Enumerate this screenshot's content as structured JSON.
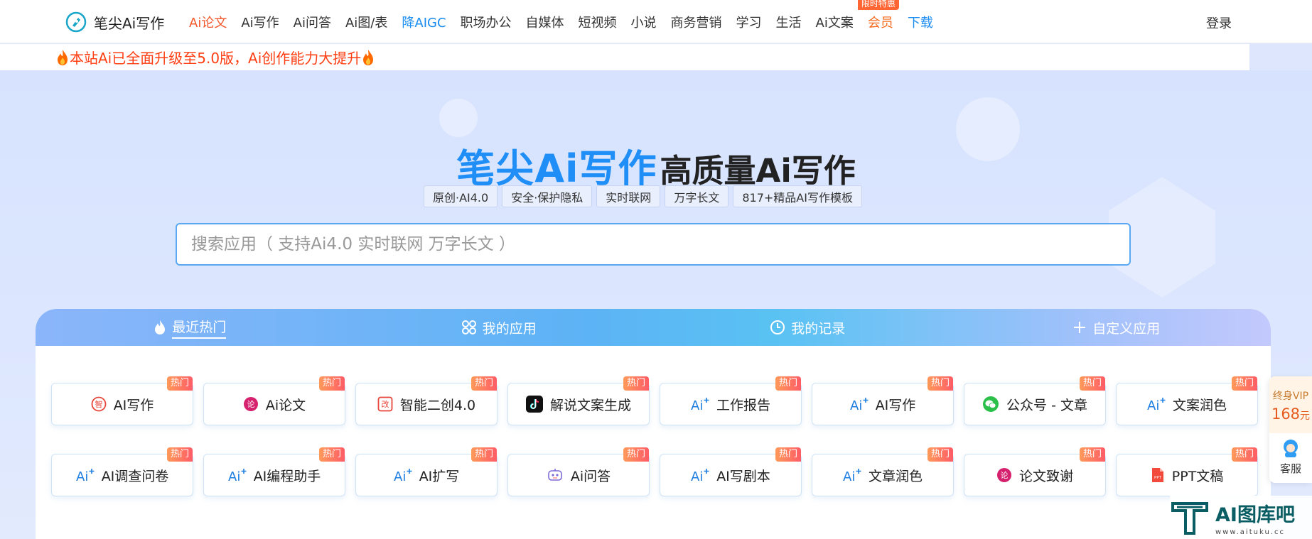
{
  "header": {
    "brand": "笔尖Ai写作",
    "nav": [
      {
        "label": "Ai论文",
        "style": "active"
      },
      {
        "label": "Ai写作",
        "style": ""
      },
      {
        "label": "Ai问答",
        "style": ""
      },
      {
        "label": "Ai图/表",
        "style": ""
      },
      {
        "label": "降AIGC",
        "style": "blue"
      },
      {
        "label": "职场办公",
        "style": ""
      },
      {
        "label": "自媒体",
        "style": ""
      },
      {
        "label": "短视频",
        "style": ""
      },
      {
        "label": "小说",
        "style": ""
      },
      {
        "label": "商务营销",
        "style": ""
      },
      {
        "label": "学习",
        "style": ""
      },
      {
        "label": "生活",
        "style": ""
      },
      {
        "label": "Ai文案",
        "style": ""
      },
      {
        "label": "会员",
        "style": "orange",
        "badge": "限时特惠"
      },
      {
        "label": "下载",
        "style": "blue"
      }
    ],
    "login": "登录"
  },
  "notice": "本站Ai已全面升级至5.0版，Ai创作能力大提升",
  "hero": {
    "title_brand": "笔尖Ai写作",
    "title_rest": "高质量Ai写作",
    "tags": [
      "原创·AI4.0",
      "安全·保护隐私",
      "实时联网",
      "万字长文",
      "817+精品AI写作模板"
    ],
    "search_placeholder": "搜索应用（ 支持Ai4.0 实时联网 万字长文 ）"
  },
  "tabs": [
    {
      "label": "最近热门",
      "icon": "flame-icon",
      "active": true
    },
    {
      "label": "我的应用",
      "icon": "grid-icon",
      "active": false
    },
    {
      "label": "我的记录",
      "icon": "clock-icon",
      "active": false
    },
    {
      "label": "自定义应用",
      "icon": "plus-icon",
      "active": false
    }
  ],
  "hot_label": "热门",
  "apps": [
    [
      {
        "label": "AI写作",
        "icon": "zhi-icon",
        "color": "#e8463b"
      },
      {
        "label": "Ai论文",
        "icon": "lun-icon",
        "color": "#d6216e"
      },
      {
        "label": "智能二创4.0",
        "icon": "gai-icon",
        "color": "#e8463b"
      },
      {
        "label": "解说文案生成",
        "icon": "douyin-icon",
        "color": "#111111"
      },
      {
        "label": "工作报告",
        "icon": "ai-sparkle-icon",
        "color": "#1f7fe0"
      },
      {
        "label": "AI写作",
        "icon": "ai-sparkle-icon",
        "color": "#1f7fe0"
      },
      {
        "label": "公众号 - 文章",
        "icon": "wechat-icon",
        "color": "#2cbf4a"
      },
      {
        "label": "文案润色",
        "icon": "ai-sparkle-icon",
        "color": "#1f7fe0"
      }
    ],
    [
      {
        "label": "AI调查问卷",
        "icon": "ai-sparkle-icon",
        "color": "#1f7fe0"
      },
      {
        "label": "AI编程助手",
        "icon": "ai-sparkle-icon",
        "color": "#1f7fe0"
      },
      {
        "label": "AI扩写",
        "icon": "ai-sparkle-icon",
        "color": "#1f7fe0"
      },
      {
        "label": "Ai问答",
        "icon": "robot-icon",
        "color": "#7b6bd6"
      },
      {
        "label": "AI写剧本",
        "icon": "ai-sparkle-icon",
        "color": "#1f7fe0"
      },
      {
        "label": "文章润色",
        "icon": "ai-sparkle-icon",
        "color": "#1f7fe0"
      },
      {
        "label": "论文致谢",
        "icon": "lun-icon",
        "color": "#d6216e"
      },
      {
        "label": "PPT文稿",
        "icon": "ppt-icon",
        "color": "#f24a3c"
      }
    ]
  ],
  "side": {
    "vip_line1": "终身VIP",
    "vip_price": "168",
    "vip_unit": "元",
    "service": "客服"
  },
  "watermark": {
    "title": "AI图库吧",
    "url": "www.aituku.cc"
  }
}
